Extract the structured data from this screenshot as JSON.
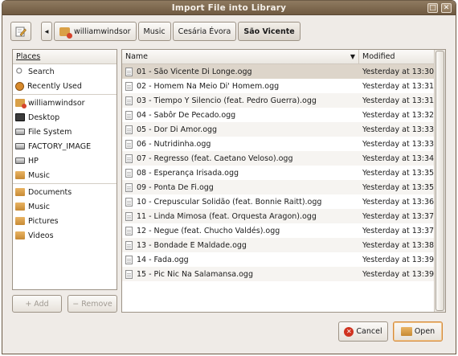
{
  "window": {
    "title": "Import File into Library",
    "maximize_glyph": "□",
    "close_glyph": "✕"
  },
  "pathbar": {
    "edit_icon": "pencil-edit-icon",
    "back_glyph": "◂",
    "crumbs": [
      {
        "label": "williamwindsor",
        "icon": "home-icon"
      },
      {
        "label": "Music"
      },
      {
        "label": "Cesária Évora"
      },
      {
        "label": "São Vicente",
        "active": true
      }
    ]
  },
  "places": {
    "header": "Places",
    "items": [
      {
        "label": "Search",
        "icon": "search-icon"
      },
      {
        "label": "Recently Used",
        "icon": "recent-icon"
      },
      {
        "label": "williamwindsor",
        "icon": "home-icon"
      },
      {
        "label": "Desktop",
        "icon": "desktop-icon"
      },
      {
        "label": "File System",
        "icon": "disk-icon"
      },
      {
        "label": "FACTORY_IMAGE",
        "icon": "disk-icon"
      },
      {
        "label": "HP",
        "icon": "disk-icon"
      },
      {
        "label": "Music",
        "icon": "folder-icon"
      },
      {
        "label": "Documents",
        "icon": "folder-icon"
      },
      {
        "label": "Music",
        "icon": "folder-icon"
      },
      {
        "label": "Pictures",
        "icon": "folder-icon"
      },
      {
        "label": "Videos",
        "icon": "folder-icon"
      }
    ],
    "add_label": "Add",
    "remove_label": "Remove"
  },
  "files": {
    "columns": {
      "name": "Name",
      "modified": "Modified",
      "sort_glyph": "▼"
    },
    "rows": [
      {
        "name": "01 - São Vicente Di Longe.ogg",
        "modified": "Yesterday at 13:30"
      },
      {
        "name": "02 - Homem Na Meio Di' Homem.ogg",
        "modified": "Yesterday at 13:31"
      },
      {
        "name": "03 - Tiempo Y Silencio (feat. Pedro Guerra).ogg",
        "modified": "Yesterday at 13:31"
      },
      {
        "name": "04 - Sabôr De Pecado.ogg",
        "modified": "Yesterday at 13:32"
      },
      {
        "name": "05 - Dor Di Amor.ogg",
        "modified": "Yesterday at 13:33"
      },
      {
        "name": "06 - Nutridinha.ogg",
        "modified": "Yesterday at 13:33"
      },
      {
        "name": "07 - Regresso (feat. Caetano Veloso).ogg",
        "modified": "Yesterday at 13:34"
      },
      {
        "name": "08 - Esperança Irisada.ogg",
        "modified": "Yesterday at 13:35"
      },
      {
        "name": "09 - Ponta De Fi.ogg",
        "modified": "Yesterday at 13:35"
      },
      {
        "name": "10 - Crepuscular Solidão (feat. Bonnie Raitt).ogg",
        "modified": "Yesterday at 13:36"
      },
      {
        "name": "11 - Linda Mimosa (feat. Orquesta Aragon).ogg",
        "modified": "Yesterday at 13:37"
      },
      {
        "name": "12 - Negue (feat. Chucho Valdés).ogg",
        "modified": "Yesterday at 13:37"
      },
      {
        "name": "13 - Bondade E Maldade.ogg",
        "modified": "Yesterday at 13:38"
      },
      {
        "name": "14 - Fada.ogg",
        "modified": "Yesterday at 13:39"
      },
      {
        "name": "15 - Pic Nic Na Salamansa.ogg",
        "modified": "Yesterday at 13:39"
      }
    ]
  },
  "buttons": {
    "cancel": "Cancel",
    "open": "Open"
  }
}
